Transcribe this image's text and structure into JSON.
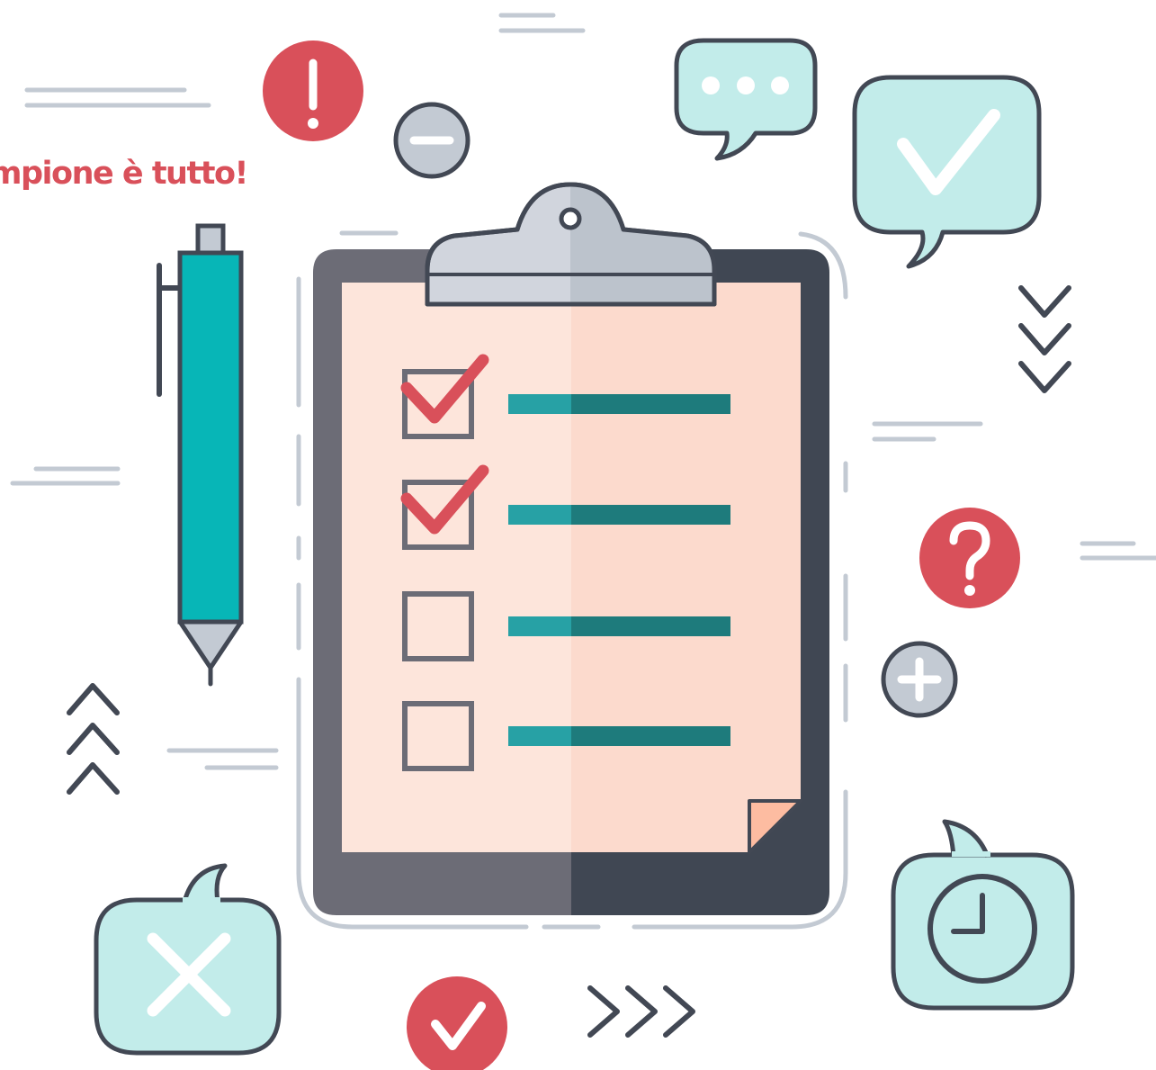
{
  "headline": {
    "text": "mpione è tutto!"
  },
  "checklist": {
    "items": [
      {
        "checked": true
      },
      {
        "checked": true
      },
      {
        "checked": false
      },
      {
        "checked": false
      }
    ]
  },
  "icons": {
    "alert": "exclamation-icon",
    "minus": "minus-icon",
    "chat": "chat-bubble-icon",
    "approve": "checkmark-bubble-icon",
    "down": "chevrons-down-icon",
    "help": "question-icon",
    "plus": "plus-icon",
    "time": "clock-bubble-icon",
    "reject": "x-bubble-icon",
    "confirm": "check-circle-icon",
    "forward": "chevrons-right-icon",
    "up": "chevrons-up-icon",
    "pen": "pen-icon",
    "clipboard": "clipboard-icon"
  },
  "colors": {
    "red": "#d9505a",
    "teal_light": "#27a1a5",
    "teal_dark": "#1e7b7c",
    "pen_body": "#07b6b7",
    "outline": "#424854",
    "paper_left": "#fde5db",
    "paper_right": "#fcdacd",
    "board_left": "#6c6c76",
    "board_right": "#404753",
    "gray_fill": "#c3cad3",
    "bubble_fill": "#c2ecea",
    "deco_line": "#c3cad3",
    "corner_fold": "#fdbca1"
  }
}
